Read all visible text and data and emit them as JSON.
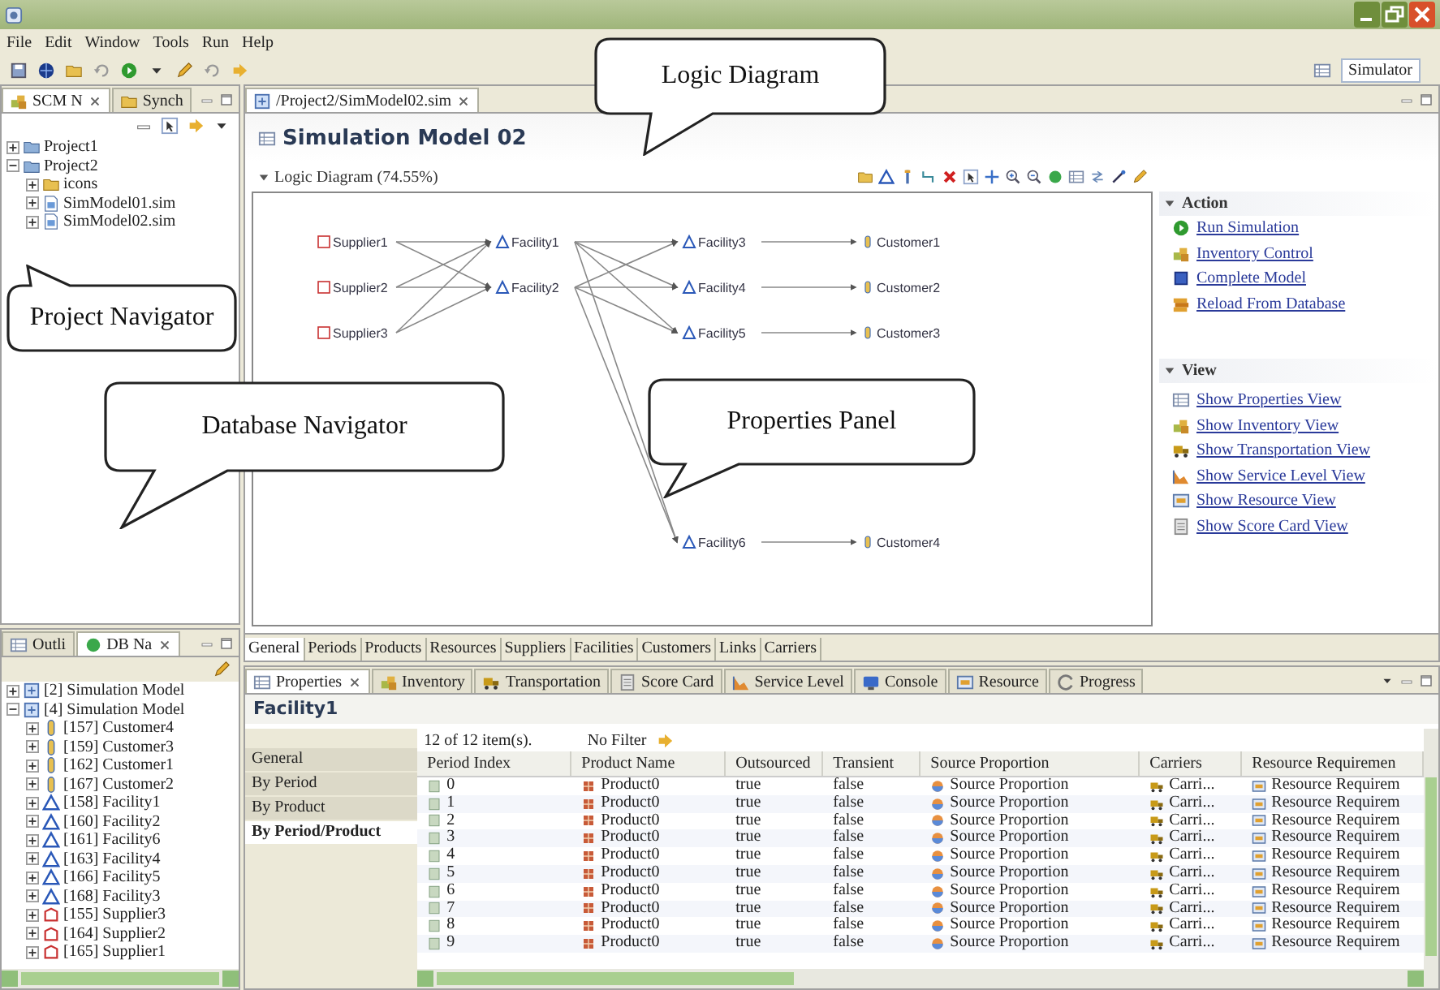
{
  "menu": [
    "File",
    "Edit",
    "Window",
    "Tools",
    "Run",
    "Help"
  ],
  "perspective": "Simulator",
  "navigator": {
    "tabs": [
      {
        "label": "SCM N",
        "selected": true
      },
      {
        "label": "Synch",
        "selected": false
      }
    ],
    "tree": [
      {
        "label": "Project1",
        "kind": "project",
        "expanded": false
      },
      {
        "label": "Project2",
        "kind": "project",
        "expanded": true,
        "children": [
          {
            "label": "icons",
            "kind": "folder",
            "expanded": false
          },
          {
            "label": "SimModel01.sim",
            "kind": "file",
            "expanded": false
          },
          {
            "label": "SimModel02.sim",
            "kind": "file",
            "expanded": false
          }
        ]
      }
    ]
  },
  "editor": {
    "tab": "/Project2/SimModel02.sim",
    "title": "Simulation Model 02",
    "section": "Logic Diagram (74.55%)",
    "nodes": [
      {
        "label": "Supplier1",
        "kind": "supplier"
      },
      {
        "label": "Supplier2",
        "kind": "supplier"
      },
      {
        "label": "Supplier3",
        "kind": "supplier"
      },
      {
        "label": "Facility1",
        "kind": "facility"
      },
      {
        "label": "Facility2",
        "kind": "facility"
      },
      {
        "label": "Facility3",
        "kind": "facility"
      },
      {
        "label": "Facility4",
        "kind": "facility"
      },
      {
        "label": "Facility5",
        "kind": "facility"
      },
      {
        "label": "Facility6",
        "kind": "facility"
      },
      {
        "label": "Customer1",
        "kind": "customer"
      },
      {
        "label": "Customer2",
        "kind": "customer"
      },
      {
        "label": "Customer3",
        "kind": "customer"
      },
      {
        "label": "Customer4",
        "kind": "customer"
      }
    ],
    "action": {
      "title": "Action",
      "links": [
        "Run Simulation",
        "Inventory Control",
        "Complete Model",
        "Reload From Database"
      ]
    },
    "view": {
      "title": "View",
      "links": [
        "Show Properties View",
        "Show Inventory View",
        "Show Transportation View",
        "Show Service Level View",
        "Show Resource View",
        "Show Score Card View"
      ]
    },
    "pages": [
      {
        "label": "General",
        "selected": true
      },
      {
        "label": "Periods",
        "selected": false
      },
      {
        "label": "Products",
        "selected": false
      },
      {
        "label": "Resources",
        "selected": false
      },
      {
        "label": "Suppliers",
        "selected": false
      },
      {
        "label": "Facilities",
        "selected": false
      },
      {
        "label": "Customers",
        "selected": false
      },
      {
        "label": "Links",
        "selected": false
      },
      {
        "label": "Carriers",
        "selected": false
      }
    ]
  },
  "db_navigator": {
    "tabs": [
      {
        "label": "Outli",
        "selected": false
      },
      {
        "label": "DB Na",
        "selected": true
      }
    ],
    "tree": [
      {
        "label": "[2] Simulation Model",
        "kind": "model",
        "expanded": false
      },
      {
        "label": "[4] Simulation Model",
        "kind": "model",
        "expanded": true,
        "children": [
          {
            "label": "[157] Customer4",
            "kind": "customer",
            "expanded": false
          },
          {
            "label": "[159] Customer3",
            "kind": "customer",
            "expanded": false
          },
          {
            "label": "[162] Customer1",
            "kind": "customer",
            "expanded": false
          },
          {
            "label": "[167] Customer2",
            "kind": "customer",
            "expanded": false
          },
          {
            "label": "[158] Facility1",
            "kind": "facility",
            "expanded": false
          },
          {
            "label": "[160] Facility2",
            "kind": "facility",
            "expanded": false
          },
          {
            "label": "[161] Facility6",
            "kind": "facility",
            "expanded": false
          },
          {
            "label": "[163] Facility4",
            "kind": "facility",
            "expanded": false
          },
          {
            "label": "[166] Facility5",
            "kind": "facility",
            "expanded": false
          },
          {
            "label": "[168] Facility3",
            "kind": "facility",
            "expanded": false
          },
          {
            "label": "[155] Supplier3",
            "kind": "supplier",
            "expanded": false
          },
          {
            "label": "[164] Supplier2",
            "kind": "supplier",
            "expanded": false
          },
          {
            "label": "[165] Supplier1",
            "kind": "supplier",
            "expanded": false
          }
        ]
      }
    ]
  },
  "properties": {
    "tabs": [
      {
        "label": "Properties",
        "selected": true
      },
      {
        "label": "Inventory",
        "selected": false
      },
      {
        "label": "Transportation",
        "selected": false
      },
      {
        "label": "Score Card",
        "selected": false
      },
      {
        "label": "Service Level",
        "selected": false
      },
      {
        "label": "Console",
        "selected": false
      },
      {
        "label": "Resource",
        "selected": false
      },
      {
        "label": "Progress",
        "selected": false
      }
    ],
    "title": "Facility1",
    "sections": [
      {
        "label": "General",
        "selected": false
      },
      {
        "label": "By Period",
        "selected": false
      },
      {
        "label": "By Product",
        "selected": false
      },
      {
        "label": "By Period/Product",
        "selected": true
      }
    ],
    "summary": "12 of 12 item(s).",
    "filter": "No Filter",
    "columns": [
      "Period Index",
      "Product Name",
      "Outsourced",
      "Transient",
      "Source Proportion",
      "Carriers",
      "Resource Requiremen"
    ],
    "rows": [
      [
        "0",
        "Product0",
        "true",
        "false",
        "Source Proportion",
        "Carri...",
        "Resource Requirem"
      ],
      [
        "1",
        "Product0",
        "true",
        "false",
        "Source Proportion",
        "Carri...",
        "Resource Requirem"
      ],
      [
        "2",
        "Product0",
        "true",
        "false",
        "Source Proportion",
        "Carri...",
        "Resource Requirem"
      ],
      [
        "3",
        "Product0",
        "true",
        "false",
        "Source Proportion",
        "Carri...",
        "Resource Requirem"
      ],
      [
        "4",
        "Product0",
        "true",
        "false",
        "Source Proportion",
        "Carri...",
        "Resource Requirem"
      ],
      [
        "5",
        "Product0",
        "true",
        "false",
        "Source Proportion",
        "Carri...",
        "Resource Requirem"
      ],
      [
        "6",
        "Product0",
        "true",
        "false",
        "Source Proportion",
        "Carri...",
        "Resource Requirem"
      ],
      [
        "7",
        "Product0",
        "true",
        "false",
        "Source Proportion",
        "Carri...",
        "Resource Requirem"
      ],
      [
        "8",
        "Product0",
        "true",
        "false",
        "Source Proportion",
        "Carri...",
        "Resource Requirem"
      ],
      [
        "9",
        "Product0",
        "true",
        "false",
        "Source Proportion",
        "Carri...",
        "Resource Requirem"
      ]
    ]
  },
  "callouts": [
    {
      "text": "Logic Diagram"
    },
    {
      "text": "Project Navigator"
    },
    {
      "text": "Database Navigator"
    },
    {
      "text": "Properties Panel"
    }
  ]
}
